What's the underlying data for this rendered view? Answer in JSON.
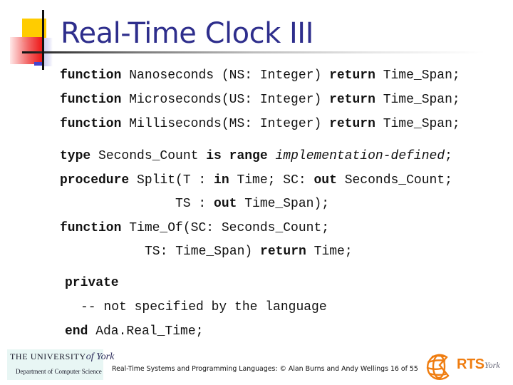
{
  "slide": {
    "title": "Real-Time Clock III",
    "page": "16 of 55"
  },
  "code": {
    "lines": [
      [
        {
          "t": "function",
          "s": "kw"
        },
        {
          "t": " Nanoseconds (NS: Integer) "
        },
        {
          "t": "return",
          "s": "kw"
        },
        {
          "t": " Time_Span;"
        }
      ],
      [
        {
          "t": "function",
          "s": "kw"
        },
        {
          "t": " Microseconds(US: Integer) "
        },
        {
          "t": "return",
          "s": "kw"
        },
        {
          "t": " Time_Span;"
        }
      ],
      [
        {
          "t": "function",
          "s": "kw"
        },
        {
          "t": " Milliseconds(MS: Integer) "
        },
        {
          "t": "return",
          "s": "kw"
        },
        {
          "t": " Time_Span;"
        }
      ],
      [
        {
          "t": "type",
          "s": "kw"
        },
        {
          "t": " Seconds_Count "
        },
        {
          "t": "is range",
          "s": "kw"
        },
        {
          "t": " "
        },
        {
          "t": "implementation-defined",
          "s": "it"
        },
        {
          "t": ";"
        }
      ],
      [
        {
          "t": "procedure",
          "s": "kw"
        },
        {
          "t": " Split(T : "
        },
        {
          "t": "in",
          "s": "kw"
        },
        {
          "t": " Time; SC: "
        },
        {
          "t": "out",
          "s": "kw"
        },
        {
          "t": " Seconds_Count;"
        }
      ],
      [
        {
          "t": "TS : "
        },
        {
          "t": "out",
          "s": "kw"
        },
        {
          "t": " Time_Span);"
        }
      ],
      [
        {
          "t": "function",
          "s": "kw"
        },
        {
          "t": " Time_Of(SC: Seconds_Count;"
        }
      ],
      [
        {
          "t": "TS: Time_Span) "
        },
        {
          "t": "return",
          "s": "kw"
        },
        {
          "t": " Time;"
        }
      ],
      [
        {
          "t": "private",
          "s": "kw"
        }
      ],
      [
        {
          "t": "-- not specified by the language"
        }
      ],
      [
        {
          "t": "end",
          "s": "kw"
        },
        {
          "t": " Ada.Real_Time;"
        }
      ]
    ]
  },
  "footer": {
    "university_logo": {
      "line1": "THE UNIVERSITY",
      "line1_script": "of York",
      "line2": "Department of Computer Science"
    },
    "caption": "Real-Time Systems and Programming Languages: © Alan Burns and Andy Wellings 16 of 55",
    "rts_logo": {
      "icon": "globe-icon",
      "text": "RTS",
      "script": "York",
      "color": "#ef7d10"
    }
  },
  "colors": {
    "title": "#2e2e8c",
    "accent_yellow": "#ffcc00",
    "accent_red": "#ee1111",
    "accent_blue": "#4444cc"
  }
}
